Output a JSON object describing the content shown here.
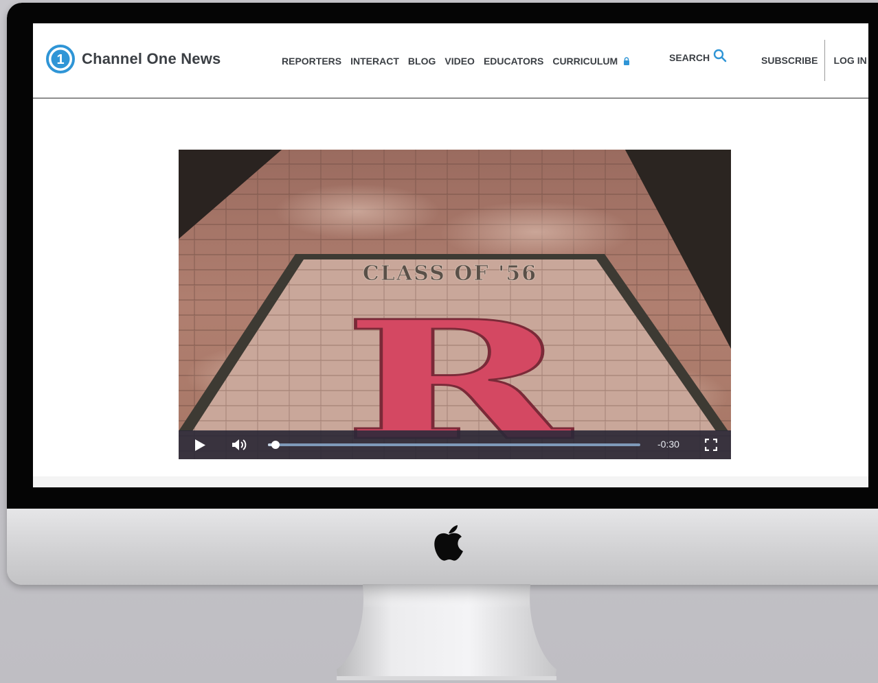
{
  "site": {
    "name": "Channel One News",
    "logo_glyph": "1",
    "brand_color": "#2f95d6"
  },
  "nav": {
    "items": [
      {
        "label": "REPORTERS"
      },
      {
        "label": "INTERACT"
      },
      {
        "label": "BLOG"
      },
      {
        "label": "VIDEO"
      },
      {
        "label": "EDUCATORS"
      },
      {
        "label": "CURRICULUM",
        "icon": "lock-icon"
      }
    ],
    "search_label": "SEARCH",
    "search_icon": "search-icon",
    "subscribe_label": "SUBSCRIBE",
    "login_label": "LOG IN"
  },
  "video": {
    "frame_text": "CLASS OF '56",
    "frame_letter": "R",
    "time_remaining": "-0:30",
    "progress": 0.02,
    "controls": [
      "play-icon",
      "volume-icon",
      "fullscreen-icon"
    ]
  },
  "device": {
    "logo_icon": "apple-logo-icon"
  }
}
